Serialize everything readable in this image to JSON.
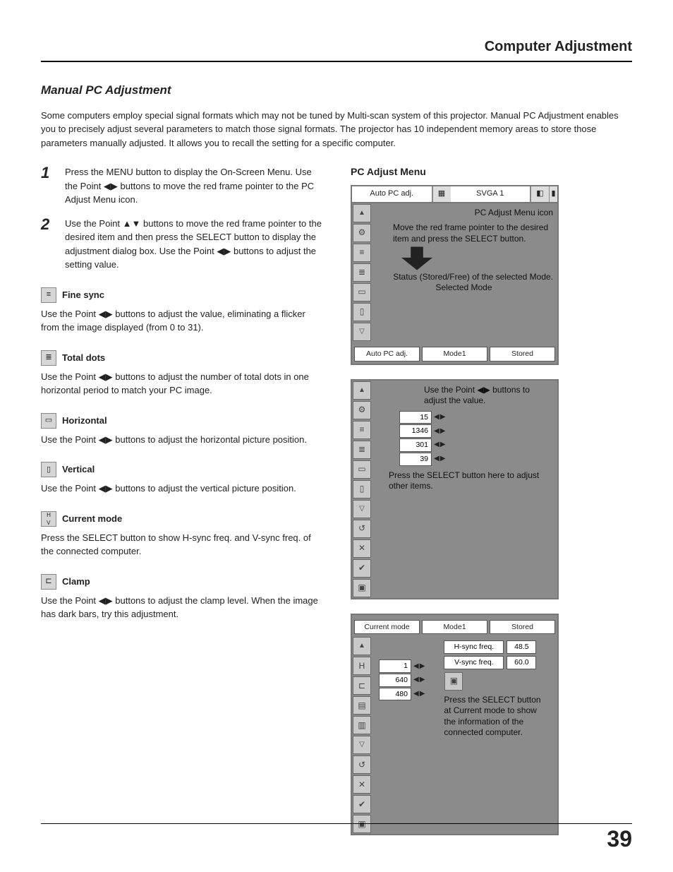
{
  "header": {
    "title": "Computer Adjustment"
  },
  "section": {
    "title": "Manual PC Adjustment"
  },
  "intro": "Some computers employ special signal formats which may not be tuned by Multi-scan system of this projector. Manual PC Adjustment enables you to precisely adjust several parameters to match those signal formats. The projector has 10 independent memory areas to store those parameters manually adjusted. It allows you to recall the setting for a specific computer.",
  "steps": {
    "s1": {
      "num": "1",
      "text": "Press the MENU button to display the On-Screen Menu. Use the Point ◀▶ buttons to move the red frame pointer to the PC Adjust Menu icon."
    },
    "s2": {
      "num": "2",
      "text": "Use the Point ▲▼ buttons to move the red frame pointer to the desired item and then press the SELECT button to display the adjustment dialog box. Use the Point ◀▶ buttons to adjust the setting value."
    }
  },
  "items": {
    "finesync": {
      "title": "Fine sync",
      "body": "Use the Point ◀▶ buttons to adjust the value, eliminating a flicker from the image displayed (from 0 to 31)."
    },
    "totaldots": {
      "title": "Total dots",
      "body": "Use the Point ◀▶ buttons to adjust the number of total dots in one horizontal period to match your PC image."
    },
    "horizontal": {
      "title": "Horizontal",
      "body": "Use the Point ◀▶ buttons to adjust the horizontal picture position."
    },
    "vertical": {
      "title": "Vertical",
      "body": "Use the Point ◀▶ buttons to adjust the vertical picture position."
    },
    "currentmode": {
      "title": "Current mode",
      "body": "Press the SELECT button to show H-sync freq. and V-sync freq. of the connected computer."
    },
    "clamp": {
      "title": "Clamp",
      "body": "Use the Point ◀▶ buttons to adjust the clamp level. When the image has dark bars, try this adjustment."
    }
  },
  "right": {
    "heading": "PC Adjust Menu",
    "top1": {
      "autopc": "Auto PC adj.",
      "svga": "SVGA 1"
    },
    "panel1": {
      "icon_label": "PC Adjust Menu icon",
      "callout1": "Move the red frame pointer to the desired item and press the SELECT button.",
      "callout_status": "Status (Stored/Free) of the selected Mode.",
      "callout_selected": "Selected Mode",
      "status": {
        "a": "Auto PC adj.",
        "b": "Mode1",
        "c": "Stored"
      }
    },
    "panel2": {
      "callout_adjust": "Use the Point ◀▶ buttons to adjust the value.",
      "v1": "15",
      "v2": "1346",
      "v3": "301",
      "v4": "39",
      "callout_down": "Press the SELECT button here to adjust other items."
    },
    "panel3": {
      "status": {
        "a": "Current mode",
        "b": "Mode1",
        "c": "Stored"
      },
      "h_label": "H-sync freq.",
      "h_val": "48.5",
      "v_label": "V-sync freq.",
      "v_val": "60.0",
      "v1": "1",
      "v2": "640",
      "v3": "480",
      "callout": "Press the SELECT button at Current mode to show the information of the connected computer."
    }
  },
  "page": "39"
}
